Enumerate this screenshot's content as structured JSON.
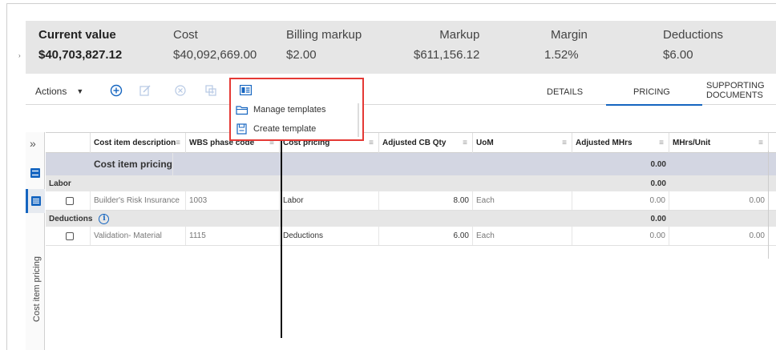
{
  "summary": {
    "metrics": [
      {
        "label": "Current value",
        "value": "$40,703,827.12"
      },
      {
        "label": "Cost",
        "value": "$40,092,669.00"
      },
      {
        "label": "Billing markup",
        "value": "$2.00"
      },
      {
        "label": "Markup",
        "value": "$611,156.12"
      },
      {
        "label": "Margin",
        "value": "1.52%"
      },
      {
        "label": "Deductions",
        "value": "$6.00"
      }
    ]
  },
  "toolbar": {
    "actions_label": "Actions",
    "tabs": [
      {
        "label": "DETAILS"
      },
      {
        "label": "PRICING"
      },
      {
        "label": "SUPPORTING DOCUMENTS"
      }
    ]
  },
  "dropdown": {
    "items": [
      {
        "label": "Manage templates",
        "icon": "folder-icon"
      },
      {
        "label": "Create template",
        "icon": "save-icon"
      }
    ]
  },
  "side": {
    "vertical_label": "Cost item pricing"
  },
  "table": {
    "columns": [
      "Cost item description",
      "WBS phase code",
      "Cost pricing",
      "Adjusted CB Qty",
      "UoM",
      "Adjusted MHrs",
      "MHrs/Unit"
    ],
    "group_title": "Cost item pricing",
    "group_total": "0.00",
    "sections": [
      {
        "name": "Labor",
        "total": "0.00",
        "rows": [
          {
            "description": "Builder's Risk Insurance",
            "wbs": "1003",
            "pricing": "Labor",
            "qty": "8.00",
            "uom": "Each",
            "mhrs": "0.00",
            "mhrs_unit": "0.00"
          }
        ]
      },
      {
        "name": "Deductions",
        "total": "0.00",
        "rows": [
          {
            "description": "Validation- Material",
            "wbs": "1115",
            "pricing": "Deductions",
            "qty": "6.00",
            "uom": "Each",
            "mhrs": "0.00",
            "mhrs_unit": "0.00"
          }
        ]
      }
    ]
  },
  "colors": {
    "accent": "#1565c0",
    "highlight_border": "#e53935",
    "summary_bg": "#e6e6e6",
    "group_bg": "#d3d6e2"
  }
}
